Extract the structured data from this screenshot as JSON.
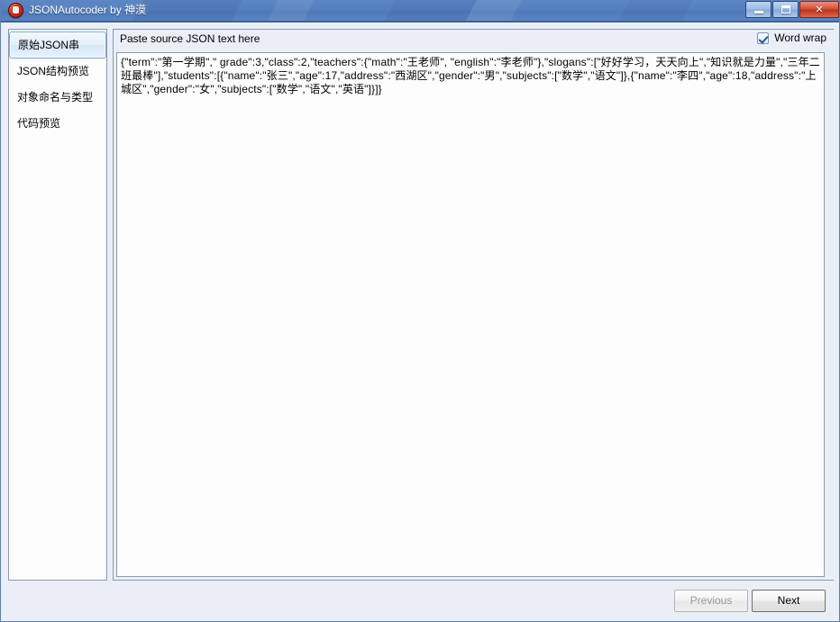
{
  "window": {
    "title": "JSONAutocoder by 神漠",
    "icon": "app-logo-icon",
    "controls": {
      "minimize": "minimize-icon",
      "maximize": "maximize-icon",
      "close": "✕"
    }
  },
  "sidebar": {
    "items": [
      {
        "label": "原始JSON串",
        "selected": true
      },
      {
        "label": "JSON结构预览",
        "selected": false
      },
      {
        "label": "对象命名与类型",
        "selected": false
      },
      {
        "label": "代码预览",
        "selected": false
      }
    ]
  },
  "main": {
    "header_label": "Paste source JSON text here",
    "word_wrap": {
      "label": "Word wrap",
      "checked": true
    },
    "json_text": "{\"term\":\"第一学期\",\" grade\":3,\"class\":2,\"teachers\":{\"math\":\"王老师\", \"english\":\"李老师\"},\"slogans\":[\"好好学习，天天向上\",\"知识就是力量\",\"三年二班最棒\"],\"students\":[{\"name\":\"张三\",\"age\":17,\"address\":\"西湖区\",\"gender\":\"男\",\"subjects\":[\"数学\",\"语文\"]},{\"name\":\"李四\",\"age\":18,\"address\":\"上城区\",\"gender\":\"女\",\"subjects\":[\"数学\",\"语文\",\"英语\"]}]}"
  },
  "footer": {
    "previous_label": "Previous",
    "next_label": "Next",
    "previous_enabled": false,
    "next_enabled": true
  },
  "colors": {
    "titlebar_blue": "#5480bf",
    "close_red": "#d4543c",
    "selection_border": "#7aa8d8",
    "panel_background": "#eaeff7",
    "field_background": "#fdfdfd",
    "border_grey": "#8a9aad"
  }
}
